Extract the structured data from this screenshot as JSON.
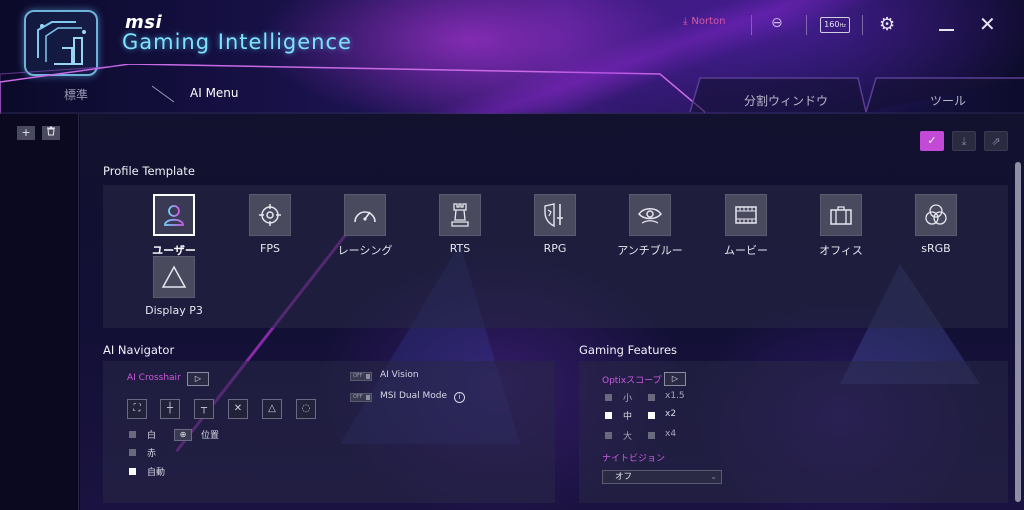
{
  "app": {
    "brand": "msi",
    "title": "Gaming Intelligence"
  },
  "toolbar": {
    "norton_label": "Norton",
    "refresh_badge": "160",
    "refresh_unit": "Hz"
  },
  "tabs": [
    {
      "label": "標準"
    },
    {
      "label": "AI Menu"
    },
    {
      "label": "分割ウィンドウ"
    },
    {
      "label": "ツール"
    }
  ],
  "sidebar": {
    "add_label": "+",
    "delete_label": "🗑"
  },
  "profile_template": {
    "title": "Profile Template",
    "items": [
      {
        "label": "ユーザー",
        "icon": "user-icon"
      },
      {
        "label": "FPS",
        "icon": "crosshair-icon"
      },
      {
        "label": "レーシング",
        "icon": "speedometer-icon"
      },
      {
        "label": "RTS",
        "icon": "chess-rook-icon"
      },
      {
        "label": "RPG",
        "icon": "shield-sword-icon"
      },
      {
        "label": "アンチブルー",
        "icon": "eye-icon"
      },
      {
        "label": "ムービー",
        "icon": "film-icon"
      },
      {
        "label": "オフィス",
        "icon": "briefcase-icon"
      },
      {
        "label": "sRGB",
        "icon": "rgb-circles-icon"
      },
      {
        "label": "Display P3",
        "icon": "triangle-icon"
      }
    ]
  },
  "ai_navigator": {
    "title": "AI Navigator",
    "crosshair_label": "AI Crosshair",
    "ai_vision_label": "AI Vision",
    "dual_mode_label": "MSI Dual Mode",
    "toggle_text": "OFF",
    "colors": [
      {
        "label": "白",
        "selected": false
      },
      {
        "label": "赤",
        "selected": false
      },
      {
        "label": "自動",
        "selected": true
      }
    ],
    "position_label": "位置"
  },
  "gaming_features": {
    "title": "Gaming Features",
    "optix_label": "Optixスコープ",
    "zoom_sizes": [
      {
        "label": "小",
        "selected": false
      },
      {
        "label": "中",
        "selected": true
      },
      {
        "label": "大",
        "selected": false
      }
    ],
    "zoom_levels": [
      {
        "label": "x1.5",
        "selected": false
      },
      {
        "label": "x2",
        "selected": true
      },
      {
        "label": "x4",
        "selected": false
      }
    ],
    "night_vision_label": "ナイトビジョン",
    "night_vision_value": "オフ"
  },
  "colors": {
    "accent": "#c24ad6",
    "title_cyan": "#7fe3ff",
    "norton": "#e0609a"
  }
}
